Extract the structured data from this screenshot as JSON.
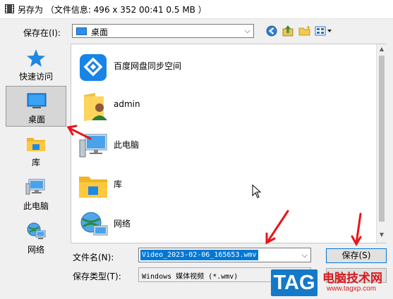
{
  "title": {
    "text": "另存为 （文件信息: 496 x 352   00:41   0.5 MB ）"
  },
  "location": {
    "label": "保存在(I):",
    "value": "桌面"
  },
  "places": [
    {
      "label": "快速访问",
      "icon": "star-icon"
    },
    {
      "label": "桌面",
      "icon": "desktop-icon",
      "selected": true
    },
    {
      "label": "库",
      "icon": "library-folder-icon"
    },
    {
      "label": "此电脑",
      "icon": "computer-icon"
    },
    {
      "label": "网络",
      "icon": "network-icon"
    }
  ],
  "files": [
    {
      "label": "百度网盘同步空间",
      "icon": "baidu-netdisk-icon"
    },
    {
      "label": "admin",
      "icon": "user-folder-icon"
    },
    {
      "label": "此电脑",
      "icon": "computer-icon"
    },
    {
      "label": "库",
      "icon": "library-folder-icon"
    },
    {
      "label": "网络",
      "icon": "network-icon"
    }
  ],
  "filename": {
    "label": "文件名(N):",
    "value": "Video_2023-02-06_165653.wmv"
  },
  "filetype": {
    "label": "保存类型(T):",
    "value": "Windows 媒体视频 (*.wmv)"
  },
  "buttons": {
    "save": "保存(S)"
  },
  "watermark": {
    "tag": "TAG",
    "site_name": "电脑技术网",
    "url": "www.tagxp.com"
  },
  "colors": {
    "accent": "#0078d7",
    "annotation_arrow": "#e8141c",
    "watermark_blue": "#1479c9"
  }
}
